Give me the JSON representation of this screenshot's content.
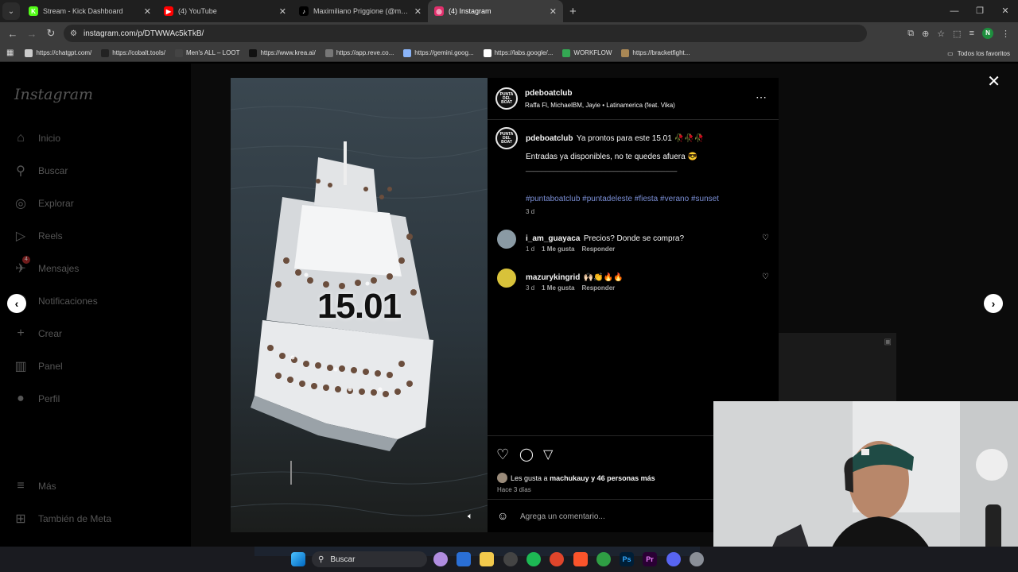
{
  "browser": {
    "tabs": [
      {
        "title": "Stream - Kick Dashboard",
        "fav_color": "#53fc18",
        "fav_letter": "K",
        "active": false
      },
      {
        "title": "(4) YouTube",
        "fav_color": "#ff0000",
        "fav_letter": "▶",
        "active": false
      },
      {
        "title": "Maximiliano Priggione (@maxi",
        "fav_color": "#000000",
        "fav_letter": "♪",
        "active": false
      },
      {
        "title": "(4) Instagram",
        "fav_color": "#e1306c",
        "fav_letter": "◎",
        "active": true
      }
    ],
    "url": "instagram.com/p/DTWWAc5kTkB/",
    "profile_letter": "N",
    "bookmarks": [
      {
        "label": "https://chatgpt.com/",
        "color": "#cccccc"
      },
      {
        "label": "https://cobalt.tools/",
        "color": "#222222"
      },
      {
        "label": "Men's ALL – LOOT",
        "color": "#444444"
      },
      {
        "label": "https://www.krea.ai/",
        "color": "#111111"
      },
      {
        "label": "https://app.reve.co...",
        "color": "#777777"
      },
      {
        "label": "https://gemini.goog...",
        "color": "#8ab4f8"
      },
      {
        "label": "https://labs.google/...",
        "color": "#ffffff"
      },
      {
        "label": "WORKFLOW",
        "color": "#34a853"
      },
      {
        "label": "https://bracketfight...",
        "color": "#aa8855"
      }
    ],
    "bookmarks_folder": "Todos los favoritos"
  },
  "instagram": {
    "logo": "Instagram",
    "nav": [
      {
        "label": "Inicio",
        "icon": "⌂"
      },
      {
        "label": "Buscar",
        "icon": "⚲"
      },
      {
        "label": "Explorar",
        "icon": "◎"
      },
      {
        "label": "Reels",
        "icon": "▷"
      },
      {
        "label": "Mensajes",
        "icon": "✈",
        "badge": "4"
      },
      {
        "label": "Notificaciones",
        "icon": "♡"
      },
      {
        "label": "Crear",
        "icon": "+"
      },
      {
        "label": "Panel",
        "icon": "▥"
      },
      {
        "label": "Perfil",
        "icon": "●"
      }
    ],
    "more": "Más",
    "meta": "También de Meta",
    "post": {
      "username": "pdeboatclub",
      "audio": "Raffa Fl, MichaelBM, Jayie • Latinamerica (feat. Vika)",
      "avatar_text": "PUNTA DEL BOAT",
      "caption_user": "pdeboatclub",
      "caption_line1": "Ya prontos para este 15.01 🥀🥀🥀",
      "caption_line2": "Entradas ya disponibles, no te quedes afuera 😎",
      "divider": "______________________________________",
      "hashtags": "#puntaboatclub #puntadeleste #fiesta #verano #sunset",
      "caption_time": "3 d",
      "video_overlay": "15.01",
      "comments": [
        {
          "user": "i_am_guayaca",
          "text": "Precios? Donde se compra?",
          "time": "1 d",
          "likes": "1 Me gusta",
          "reply": "Responder"
        },
        {
          "user": "mazurykingrid",
          "text": "🙌🏻👏🔥🔥",
          "time": "3 d",
          "likes": "1 Me gusta",
          "reply": "Responder"
        }
      ],
      "likes_text_prefix": "Les gusta a",
      "likes_user": "machukauy",
      "likes_rest": "y 46 personas más",
      "posted": "Hace 3 días",
      "comment_placeholder": "Agrega un comentario..."
    }
  },
  "taskbar": {
    "search": "Buscar"
  }
}
